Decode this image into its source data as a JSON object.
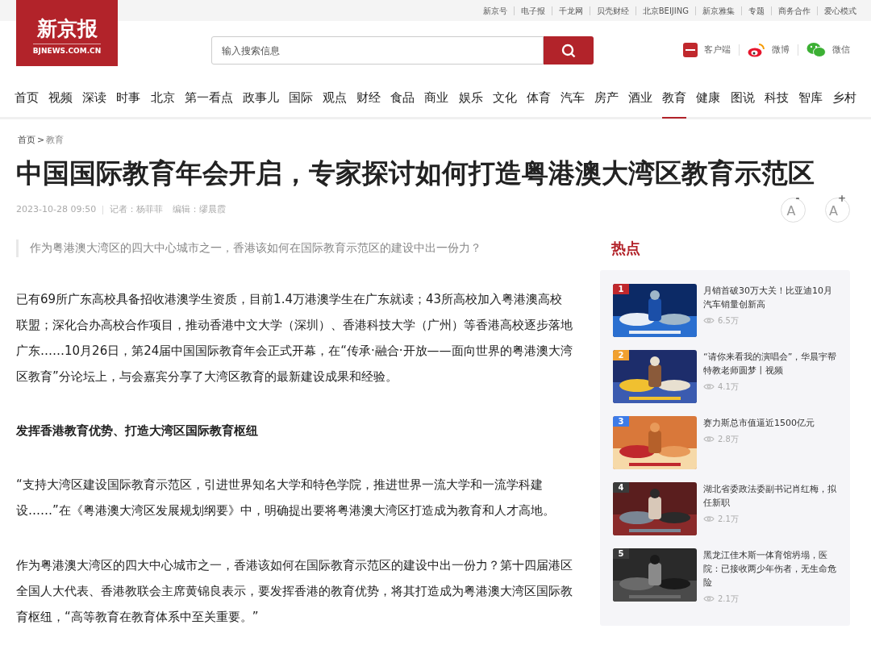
{
  "top_links": [
    "新京号",
    "电子报",
    "千龙网",
    "贝壳财经",
    "北京BEIJING",
    "新京雅集",
    "专题",
    "商务合作",
    "爱心模式"
  ],
  "logo": {
    "name": "新京报",
    "domain": "BJNEWS.COM.CN"
  },
  "search": {
    "placeholder": "输入搜索信息"
  },
  "header_links": [
    {
      "kind": "app",
      "label": "客户端"
    },
    {
      "kind": "weibo",
      "label": "微博"
    },
    {
      "kind": "wechat",
      "label": "微信"
    }
  ],
  "nav": [
    {
      "label": "首页",
      "selected": false
    },
    {
      "label": "视频",
      "selected": false
    },
    {
      "label": "深读",
      "selected": false
    },
    {
      "label": "时事",
      "selected": false
    },
    {
      "label": "北京",
      "selected": false
    },
    {
      "label": "第一看点",
      "selected": false
    },
    {
      "label": "政事儿",
      "selected": false
    },
    {
      "label": "国际",
      "selected": false
    },
    {
      "label": "观点",
      "selected": false
    },
    {
      "label": "财经",
      "selected": false
    },
    {
      "label": "食品",
      "selected": false
    },
    {
      "label": "商业",
      "selected": false
    },
    {
      "label": "娱乐",
      "selected": false
    },
    {
      "label": "文化",
      "selected": false
    },
    {
      "label": "体育",
      "selected": false
    },
    {
      "label": "汽车",
      "selected": false
    },
    {
      "label": "房产",
      "selected": false
    },
    {
      "label": "酒业",
      "selected": false
    },
    {
      "label": "教育",
      "selected": true
    },
    {
      "label": "健康",
      "selected": false
    },
    {
      "label": "图说",
      "selected": false
    },
    {
      "label": "科技",
      "selected": false
    },
    {
      "label": "智库",
      "selected": false
    },
    {
      "label": "乡村",
      "selected": false
    }
  ],
  "breadcrumb": [
    "首页",
    ">",
    "教育"
  ],
  "article": {
    "title": "中国国际教育年会开启，专家探讨如何打造粤港澳大湾区教育示范区",
    "date": "2023-10-28 09:50",
    "reporter": "记者：杨菲菲",
    "editor": "编辑：缪晨霞",
    "font_buttons": [
      {
        "label": "A",
        "sign": "-"
      },
      {
        "label": "A",
        "sign": "+"
      }
    ],
    "summary": "作为粤港澳大湾区的四大中心城市之一，香港该如何在国际教育示范区的建设中出一份力？",
    "blocks": [
      {
        "kind": "paragraph",
        "text": "已有69所广东高校具备招收港澳学生资质，目前1.4万港澳学生在广东就读；43所高校加入粤港澳高校联盟；深化合办高校合作项目，推动香港中文大学（深圳）、香港科技大学（广州）等香港高校逐步落地广东……10月26日，第24届中国国际教育年会正式开幕，在“传承·融合·开放——面向世界的粤港澳大湾区教育”分论坛上，与会嘉宾分享了大湾区教育的最新建设成果和经验。"
      },
      {
        "kind": "heading",
        "text": "发挥香港教育优势、打造大湾区国际教育枢纽"
      },
      {
        "kind": "paragraph",
        "text": "“支持大湾区建设国际教育示范区，引进世界知名大学和特色学院，推进世界一流大学和一流学科建设……”在《粤港澳大湾区发展规划纲要》中，明确提出要将粤港澳大湾区打造成为教育和人才高地。"
      },
      {
        "kind": "paragraph",
        "text": "作为粤港澳大湾区的四大中心城市之一，香港该如何在国际教育示范区的建设中出一份力？第十四届港区全国人大代表、香港教联会主席黄锦良表示，要发挥香港的教育优势，将其打造成为粤港澳大湾区国际教育枢纽，“高等教育在教育体系中至关重要。”"
      }
    ]
  },
  "hot": {
    "title": "热点",
    "items": [
      {
        "rank": "1",
        "color": "#c0282d",
        "title": "月销首破30万大关！比亚迪10月汽车销量创新高",
        "views": "6.5万",
        "kind": "picture"
      },
      {
        "rank": "2",
        "color": "#f0a030",
        "title": "“请你来看我的演唱会”，华晨宇帮特教老师圆梦丨视频",
        "views": "4.1万",
        "kind": "picture"
      },
      {
        "rank": "3",
        "color": "#3d7be8",
        "title": "赛力斯总市值逼近1500亿元",
        "views": "2.8万",
        "kind": "picture"
      },
      {
        "rank": "4",
        "color": "#3a3a3a",
        "title": "湖北省委政法委副书记肖红梅，拟任新职",
        "views": "2.1万",
        "kind": "picture"
      },
      {
        "rank": "5",
        "color": "#3a3a3a",
        "title": "黑龙江佳木斯一体育馆坍塌，医院：已接收两少年伤者，无生命危险",
        "views": "2.1万",
        "kind": "picture"
      }
    ]
  }
}
